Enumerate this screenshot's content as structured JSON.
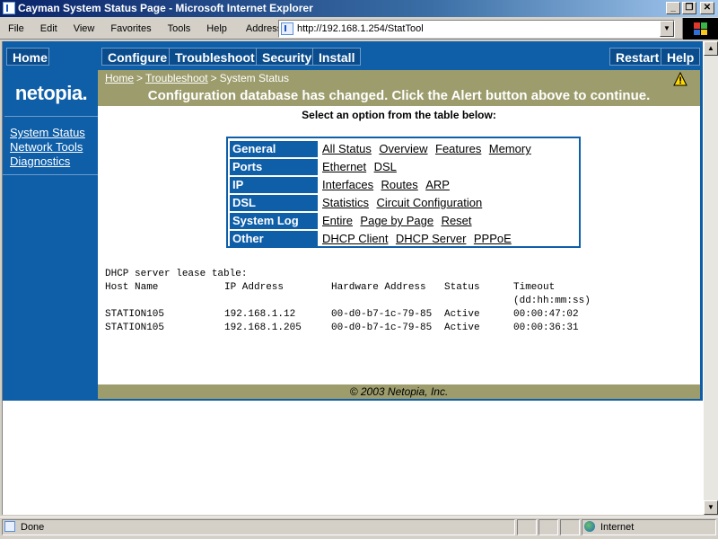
{
  "window": {
    "title": "Cayman System Status Page - Microsoft Internet Explorer",
    "buttons": {
      "minimize": "_",
      "maximize": "❐",
      "close": "✕"
    }
  },
  "menubar": [
    "File",
    "Edit",
    "View",
    "Favorites",
    "Tools",
    "Help"
  ],
  "address": {
    "label": "Address",
    "url": "http://192.168.1.254/StatTool"
  },
  "topnav": {
    "home": "Home",
    "configure": "Configure",
    "troubleshoot": "Troubleshoot",
    "security": "Security",
    "install": "Install",
    "restart": "Restart",
    "help": "Help"
  },
  "logo": "netopia.",
  "sidebar": [
    "System Status",
    "Network Tools",
    "Diagnostics"
  ],
  "breadcrumb": {
    "home": "Home",
    "troubleshoot": "Troubleshoot",
    "current": "System Status",
    "sep": ">"
  },
  "alert": "Configuration database has changed. Click the Alert button above to continue.",
  "instruction": "Select an option from the table below:",
  "options": [
    {
      "category": "General",
      "links": [
        "All Status",
        "Overview",
        "Features",
        "Memory"
      ]
    },
    {
      "category": "Ports",
      "links": [
        "Ethernet",
        "DSL"
      ]
    },
    {
      "category": "IP",
      "links": [
        "Interfaces",
        "Routes",
        "ARP"
      ]
    },
    {
      "category": "DSL",
      "links": [
        "Statistics",
        "Circuit Configuration"
      ]
    },
    {
      "category": "System Log",
      "links": [
        "Entire",
        "Page by Page",
        "Reset"
      ]
    },
    {
      "category": "Other",
      "links": [
        "DHCP Client",
        "DHCP Server",
        "PPPoE"
      ]
    }
  ],
  "lease_table": {
    "title": "DHCP server lease table:",
    "headers": [
      "Host Name",
      "IP Address",
      "Hardware Address",
      "Status",
      "Timeout"
    ],
    "timeout_format": "(dd:hh:mm:ss)",
    "rows": [
      [
        "STATION105",
        "192.168.1.12",
        "00-d0-b7-1c-79-85",
        "Active",
        "00:00:47:02"
      ],
      [
        "STATION105",
        "192.168.1.205",
        "00-d0-b7-1c-79-85",
        "Active",
        "00:00:36:31"
      ]
    ]
  },
  "footer": "© 2003 Netopia, Inc.",
  "statusbar": {
    "status": "Done",
    "zone": "Internet"
  },
  "colors": {
    "nav_blue": "#0e5ea8",
    "olive": "#9c9c6c",
    "title_blue": "#0a246a"
  }
}
